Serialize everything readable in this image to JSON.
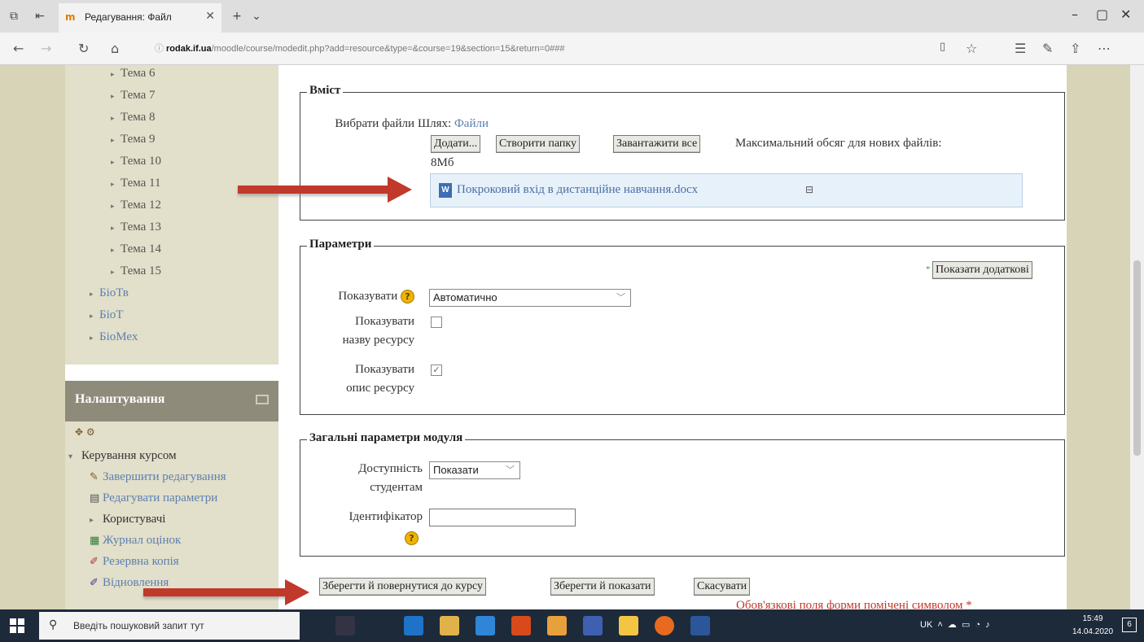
{
  "browser": {
    "tab_title": "Редагування: Файл",
    "url_host": "rodak.if.ua",
    "url_path": "/moodle/course/modedit.php?add=resource&type=&course=19&section=15&return=0###"
  },
  "sidebar": {
    "topics": [
      "Тема 6",
      "Тема 7",
      "Тема 8",
      "Тема 9",
      "Тема 10",
      "Тема 11",
      "Тема 12",
      "Тема 13",
      "Тема 14",
      "Тема 15"
    ],
    "courses": [
      "БіоТв",
      "БіоТ",
      "БіоМех"
    ],
    "settings_title": "Налаштування",
    "course_admin": "Керування курсом",
    "admin_items": [
      "Завершити редагування",
      "Редагувати параметри",
      "Користувачі",
      "Журнал оцінок",
      "Резервна копія",
      "Відновлення"
    ]
  },
  "content_section": {
    "legend": "Вміст",
    "select_files_label": "Вибрати файли",
    "path_label": "Шлях:",
    "path_link": "Файли",
    "add_button": "Додати...",
    "create_folder_button": "Створити папку",
    "download_all_button": "Завантажити все",
    "max_size_text": "Максимальний обсяг для нових файлів:",
    "max_size_value": "8Мб",
    "file_name": "Покроковий вхід в дистанційне навчання.docx"
  },
  "params_section": {
    "legend": "Параметри",
    "show_advanced_button": "Показати додаткові",
    "display_label": "Показувати",
    "display_value": "Автоматично",
    "show_name_label_1": "Показувати",
    "show_name_label_2": "назву ресурсу",
    "show_name_checked": false,
    "show_desc_label_1": "Показувати",
    "show_desc_label_2": "опис ресурсу",
    "show_desc_checked": true
  },
  "module_section": {
    "legend": "Загальні параметри модуля",
    "visibility_label_1": "Доступність",
    "visibility_label_2": "студентам",
    "visibility_value": "Показати",
    "id_label": "Ідентифікатор",
    "id_value": ""
  },
  "actions": {
    "save_return": "Зберегти й повернутися до курсу",
    "save_show": "Зберегти й показати",
    "cancel": "Скасувати",
    "required_note": "Обов'язкові поля форми помічені символом"
  },
  "taskbar": {
    "search_placeholder": "Введіть пошуковий запит тут",
    "language": "UK",
    "time": "15:49",
    "date": "14.04.2020",
    "notifications": "6"
  },
  "colors": {
    "sidebar_bg": "#d8d4b7",
    "block_header": "#8f8b7a",
    "arrow": "#c0392b",
    "link": "#5d7fb0"
  }
}
